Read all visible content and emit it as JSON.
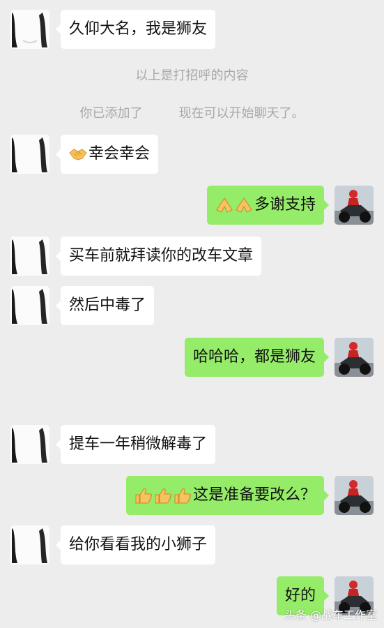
{
  "colors": {
    "background": "#ededed",
    "incoming_bubble": "#ffffff",
    "outgoing_bubble": "#95ec69",
    "system_text": "#a8a8a8"
  },
  "messages": [
    {
      "from": "contact",
      "text": "久仰大名，我是狮友",
      "emoji": []
    },
    {
      "from": "system",
      "text": "以上是打招呼的内容"
    },
    {
      "from": "system",
      "text_before": "你已添加了",
      "text_after": "现在可以开始聊天了。"
    },
    {
      "from": "contact",
      "text": "幸会幸会",
      "emoji": [
        "handshake-emoji"
      ]
    },
    {
      "from": "me",
      "text": "多谢支持",
      "emoji": [
        "folded-hands-emoji",
        "folded-hands-emoji"
      ]
    },
    {
      "from": "contact",
      "text": "买车前就拜读你的改车文章",
      "emoji": []
    },
    {
      "from": "contact",
      "text": "然后中毒了",
      "emoji": []
    },
    {
      "from": "me",
      "text": "哈哈哈，都是狮友",
      "emoji": []
    },
    {
      "from": "contact",
      "text": "提车一年稍微解毒了",
      "emoji": []
    },
    {
      "from": "me",
      "text": "这是准备要改么？",
      "emoji": [
        "thumbs-up-emoji",
        "thumbs-up-emoji",
        "thumbs-up-emoji"
      ]
    },
    {
      "from": "contact",
      "text": "给你看看我的小狮子",
      "emoji": []
    },
    {
      "from": "me",
      "text": "好的",
      "emoji": []
    }
  ],
  "avatars": {
    "contact": "contact-avatar",
    "me": "motorcycle-rider-avatar"
  },
  "watermark": "头条 @战车工作室"
}
